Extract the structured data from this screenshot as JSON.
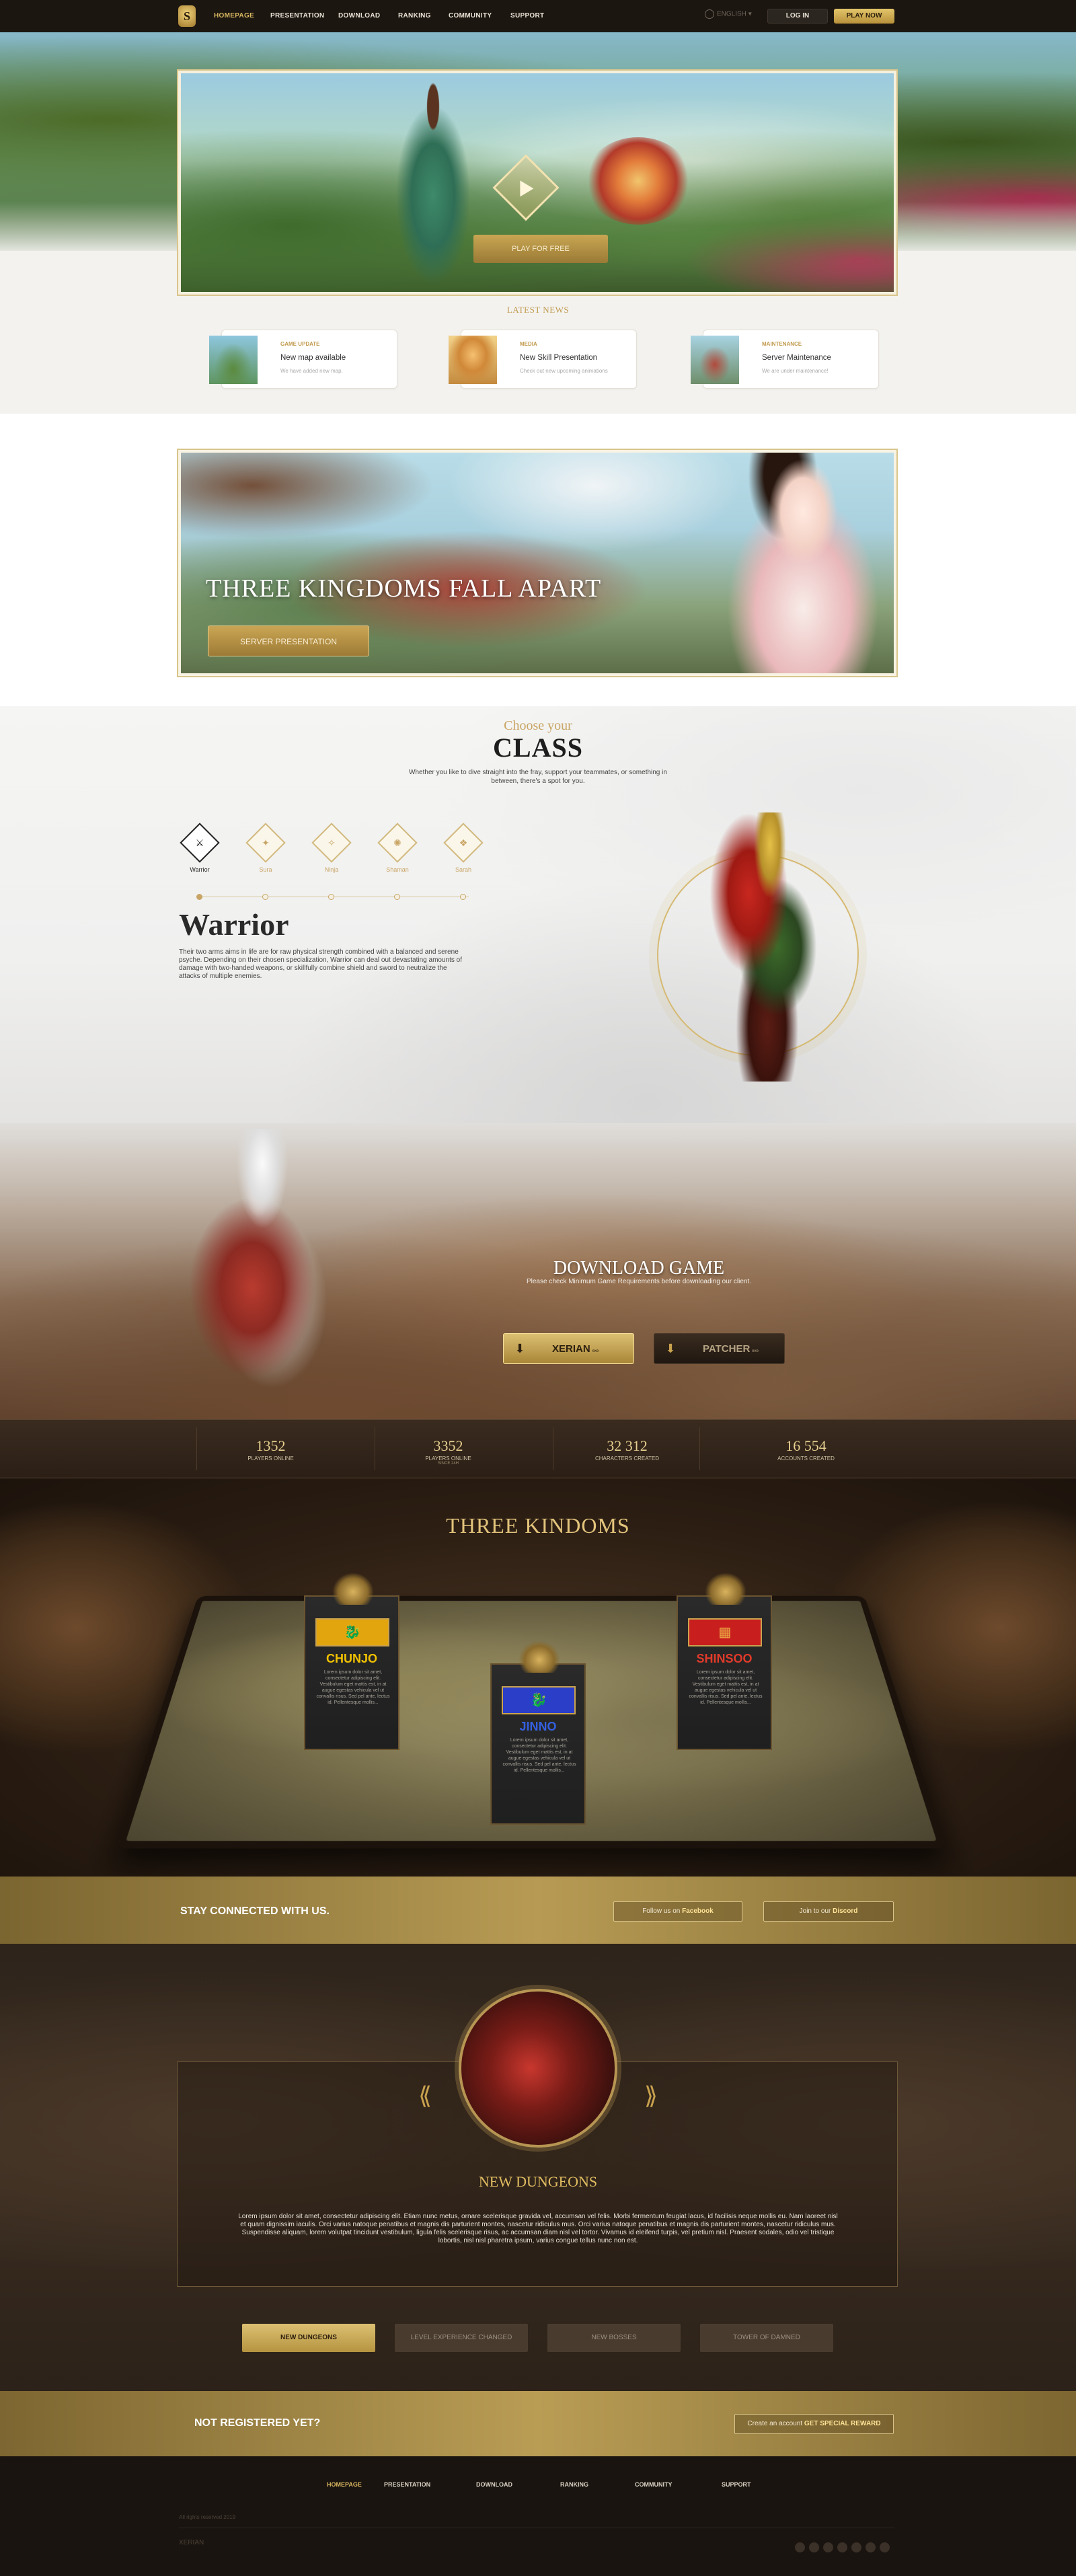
{
  "nav": {
    "logo": "S",
    "items": [
      "HOMEPAGE",
      "PRESENTATION",
      "DOWNLOAD",
      "RANKING",
      "COMMUNITY",
      "SUPPORT"
    ],
    "language": "ENGLISH",
    "login": "LOG IN",
    "play": "PLAY NOW"
  },
  "hero": {
    "cta": "PLAY FOR FREE"
  },
  "news": {
    "title": "LATEST NEWS",
    "items": [
      {
        "category": "GAME UPDATE",
        "title": "New map available",
        "desc": "We have added new map."
      },
      {
        "category": "MEDIA",
        "title": "New Skill Presentation",
        "desc": "Check out new upcoming animations"
      },
      {
        "category": "MAINTENANCE",
        "title": "Server Maintenance",
        "desc": "We are under maintenance!"
      }
    ]
  },
  "server": {
    "headline": "THREE KINGDOMS FALL APART",
    "button": "SERVER PRESENTATION"
  },
  "classes": {
    "small_title": "Choose your",
    "big_title": "CLASS",
    "description": "Whether you like to dive straight into the fray, support your teammates, or something in between, there's a spot for you.",
    "items": [
      {
        "label": "Warrior",
        "glyph": "⚔"
      },
      {
        "label": "Sura",
        "glyph": "✦"
      },
      {
        "label": "Ninja",
        "glyph": "✧"
      },
      {
        "label": "Shaman",
        "glyph": "✺"
      },
      {
        "label": "Sarah",
        "glyph": "❖"
      }
    ],
    "selected_name": "Warrior",
    "selected_text": "Their two arms aims in life are for raw physical strength combined with a balanced and serene psyche. Depending on their chosen specialization, Warrior can deal out devastating amounts of damage with two-handed weapons, or skillfully combine shield and sword to neutralize the attacks of multiple enemies."
  },
  "download": {
    "title": "DOWNLOAD GAME",
    "subtitle": "Please check Minimum Game Requirements before downloading our client.",
    "primary": {
      "label": "XERIAN",
      "suffix": "exe"
    },
    "secondary": {
      "label": "PATCHER",
      "suffix": "exe"
    }
  },
  "stats": [
    {
      "value": "1352",
      "label": "PLAYERS ONLINE",
      "sub": ""
    },
    {
      "value": "3352",
      "label": "PLAYERS ONLINE",
      "sub": "SINCE 24H"
    },
    {
      "value": "32 312",
      "label": "CHARACTERS CREATED",
      "sub": ""
    },
    {
      "value": "16 554",
      "label": "ACCOUNTS CREATED",
      "sub": ""
    }
  ],
  "kingdoms": {
    "title": "THREE KINDOMS",
    "items": [
      {
        "name": "CHUNJO",
        "desc": "Lorem ipsum dolor sit amet, consectetur adipiscing elit. Vestibulum eget mattis est, in at augue egestas vehicula vel ut convallis risus. Sed pel ante, lectus id. Pellentesque mollis...",
        "color": "#f2c200",
        "flag_bg": "#e3a50e",
        "flag_glyph": "🐉"
      },
      {
        "name": "JINNO",
        "desc": "Lorem ipsum dolor sit amet, consectetur adipiscing elit. Vestibulum eget mattis est, in at augue egestas vehicula vel ut convallis risus. Sed pel ante, lectus id. Pellentesque mollis...",
        "color": "#3460e0",
        "flag_bg": "#2a3ec8",
        "flag_glyph": "🐉"
      },
      {
        "name": "SHINSOO",
        "desc": "Lorem ipsum dolor sit amet, consectetur adipiscing elit. Vestibulum eget mattis est, in at augue egestas vehicula vel ut convallis risus. Sed pel ante, lectus id. Pellentesque mollis...",
        "color": "#e03a2a",
        "flag_bg": "#c81e1e",
        "flag_glyph": "▦"
      }
    ]
  },
  "connect": {
    "text": "STAY CONNECTED WITH US.",
    "facebook_prefix": "Follow us on",
    "facebook": "Facebook",
    "discord_prefix": "Join to our",
    "discord": "Discord"
  },
  "dungeons": {
    "title": "NEW DUNGEONS",
    "text": "Lorem ipsum dolor sit amet, consectetur adipiscing elit. Etiam nunc metus, ornare scelerisque gravida vel, accumsan vel felis. Morbi fermentum feugiat lacus, id facilisis neque mollis eu. Nam laoreet nisl et quam dignissim iaculis. Orci varius natoque penatibus et magnis dis parturient montes, nascetur ridiculus mus. Orci varius natoque penatibus et magnis dis parturient montes, nascetur ridiculus mus. Suspendisse aliquam, lorem volutpat tincidunt vestibulum, ligula felis scelerisque risus, ac accumsan diam nisl vel tortor. Vivamus id eleifend turpis, vel pretium nisl. Praesent sodales, odio vel tristique lobortis, nisl nisl pharetra ipsum, varius congue tellus nunc non est.",
    "tabs": [
      "NEW DUNGEONS",
      "LEVEL EXPERIENCE CHANGED",
      "NEW BOSSES",
      "TOWER OF DAMNED"
    ]
  },
  "register": {
    "text": "NOT REGISTERED YET?",
    "btn_prefix": "Create an account",
    "btn_strong": "GET SPECIAL REWARD"
  },
  "footer": {
    "items": [
      "HOMEPAGE",
      "PRESENTATION",
      "DOWNLOAD",
      "RANKING",
      "COMMUNITY",
      "SUPPORT"
    ],
    "copyright": "All rights reserved 2019",
    "brand": "XERIAN"
  }
}
